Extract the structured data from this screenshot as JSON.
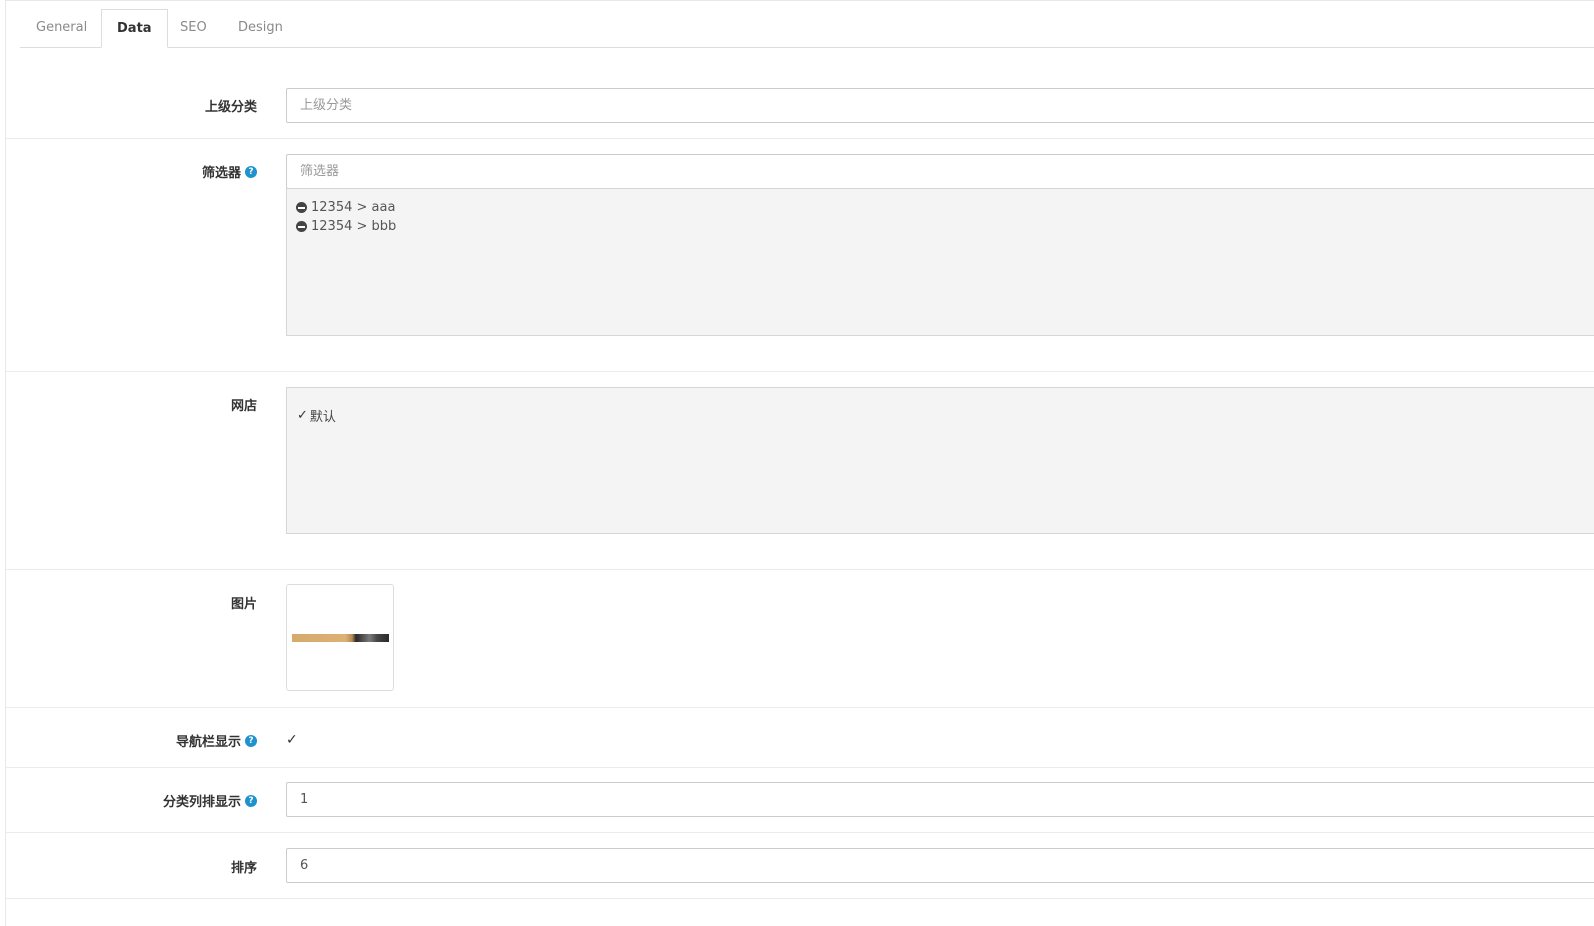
{
  "tabs": [
    {
      "label": "General",
      "active": false
    },
    {
      "label": "Data",
      "active": true
    },
    {
      "label": "SEO",
      "active": false
    },
    {
      "label": "Design",
      "active": false
    }
  ],
  "form": {
    "parent_category": {
      "label": "上级分类",
      "placeholder": "上级分类",
      "value": ""
    },
    "filter": {
      "label": "筛选器",
      "placeholder": "筛选器",
      "items": [
        "12354 > aaa",
        "12354 > bbb"
      ]
    },
    "store": {
      "label": "网店",
      "options": [
        {
          "label": "默认",
          "checked": true
        }
      ]
    },
    "image": {
      "label": "图片"
    },
    "nav_display": {
      "label": "导航栏显示",
      "checked": true
    },
    "category_columns": {
      "label": "分类列排显示",
      "value": "1"
    },
    "sort_order": {
      "label": "排序",
      "value": "6"
    }
  },
  "icons": {
    "help": "question-circle-icon",
    "remove": "minus-circle-icon",
    "check": "check-icon"
  },
  "colors": {
    "help_blue": "#1e91cf",
    "well_bg": "#f4f4f4"
  }
}
